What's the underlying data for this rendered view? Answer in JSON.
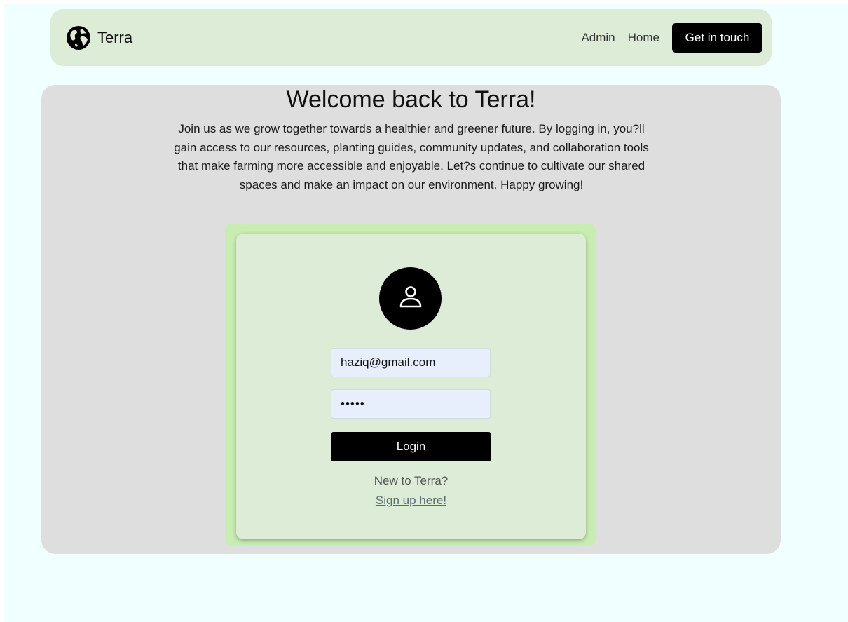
{
  "navbar": {
    "brand_name": "Terra",
    "links": [
      "Admin",
      "Home"
    ],
    "cta_label": "Get in touch"
  },
  "main": {
    "title": "Welcome back to Terra!",
    "intro": "Join us as we grow together towards a healthier and greener future. By logging in, you?ll gain access to our resources, planting guides, community updates, and collaboration tools that make farming more accessible and enjoyable. Let?s continue to cultivate our shared spaces and make an impact on our environment. Happy growing!"
  },
  "login_card": {
    "email_value": "haziq@gmail.com",
    "password_value": "•••••",
    "login_label": "Login",
    "signup_prompt": "New to Terra?",
    "signup_link": "Sign up here!"
  },
  "icons": {
    "brand": "globe-icon",
    "avatar": "user-icon"
  },
  "colors": {
    "page_background": "#f0ffff",
    "navbar_background": "#ddecd6",
    "panel_background": "#dedede",
    "card_glow": "#c8ecb2",
    "input_background": "#e8effc",
    "button_background": "#000000"
  }
}
